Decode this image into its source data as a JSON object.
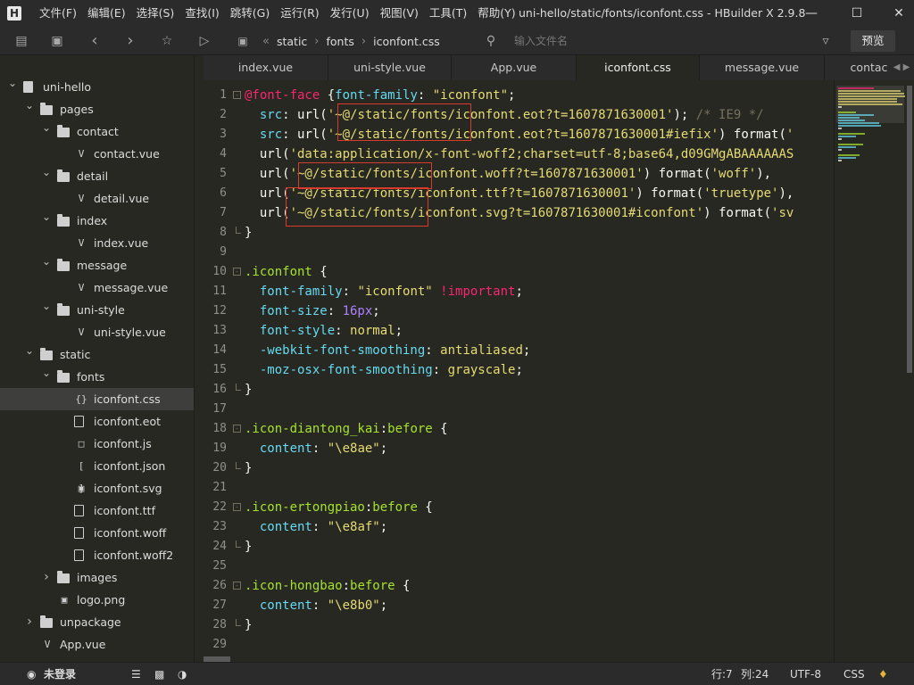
{
  "titlebar": {
    "app_icon": "H",
    "menu": [
      "文件(F)",
      "编辑(E)",
      "选择(S)",
      "查找(I)",
      "跳转(G)",
      "运行(R)",
      "发行(U)",
      "视图(V)",
      "工具(T)",
      "帮助(Y)"
    ],
    "title": "uni-hello/static/fonts/iconfont.css - HBuilder X 2.9.8",
    "controls": [
      "minimize-icon",
      "maximize-icon",
      "close-icon"
    ]
  },
  "toolbar": {
    "icons": [
      "new-file-icon",
      "save-icon",
      "back-icon",
      "forward-icon",
      "star-icon",
      "run-icon"
    ],
    "breadcrumb": [
      "static",
      "fonts",
      "iconfont.css"
    ],
    "search_placeholder": "输入文件名",
    "filter_icon": "filter-icon",
    "preview_label": "预览"
  },
  "sidebar": {
    "items": [
      {
        "label": "uni-hello",
        "type": "project",
        "depth": 0,
        "expanded": true
      },
      {
        "label": "pages",
        "type": "folder",
        "depth": 1,
        "expanded": true
      },
      {
        "label": "contact",
        "type": "folder",
        "depth": 2,
        "expanded": true
      },
      {
        "label": "contact.vue",
        "type": "vue",
        "depth": 3
      },
      {
        "label": "detail",
        "type": "folder",
        "depth": 2,
        "expanded": true
      },
      {
        "label": "detail.vue",
        "type": "vue",
        "depth": 3
      },
      {
        "label": "index",
        "type": "folder",
        "depth": 2,
        "expanded": true
      },
      {
        "label": "index.vue",
        "type": "vue",
        "depth": 3
      },
      {
        "label": "message",
        "type": "folder",
        "depth": 2,
        "expanded": true
      },
      {
        "label": "message.vue",
        "type": "vue",
        "depth": 3
      },
      {
        "label": "uni-style",
        "type": "folder",
        "depth": 2,
        "expanded": true
      },
      {
        "label": "uni-style.vue",
        "type": "vue",
        "depth": 3
      },
      {
        "label": "static",
        "type": "folder",
        "depth": 1,
        "expanded": true
      },
      {
        "label": "fonts",
        "type": "folder",
        "depth": 2,
        "expanded": true
      },
      {
        "label": "iconfont.css",
        "type": "css",
        "depth": 3,
        "selected": true
      },
      {
        "label": "iconfont.eot",
        "type": "file",
        "depth": 3
      },
      {
        "label": "iconfont.js",
        "type": "js",
        "depth": 3
      },
      {
        "label": "iconfont.json",
        "type": "json",
        "depth": 3
      },
      {
        "label": "iconfont.svg",
        "type": "image",
        "depth": 3
      },
      {
        "label": "iconfont.ttf",
        "type": "file",
        "depth": 3
      },
      {
        "label": "iconfont.woff",
        "type": "file",
        "depth": 3
      },
      {
        "label": "iconfont.woff2",
        "type": "file",
        "depth": 3
      },
      {
        "label": "images",
        "type": "folder",
        "depth": 2,
        "expanded": false
      },
      {
        "label": "logo.png",
        "type": "image",
        "depth": 2
      },
      {
        "label": "unpackage",
        "type": "folder",
        "depth": 1,
        "expanded": false
      },
      {
        "label": "App.vue",
        "type": "vue",
        "depth": 1
      }
    ]
  },
  "tabs": [
    {
      "label": "index.vue",
      "active": false
    },
    {
      "label": "uni-style.vue",
      "active": false
    },
    {
      "label": "App.vue",
      "active": false
    },
    {
      "label": "iconfont.css",
      "active": true
    },
    {
      "label": "message.vue",
      "active": false
    },
    {
      "label": "contac",
      "active": false
    }
  ],
  "editor": {
    "lines": [
      [
        [
          "k",
          "@font-face"
        ],
        [
          "w",
          " {"
        ],
        [
          "p",
          "font-family"
        ],
        [
          "w",
          ": "
        ],
        [
          "s",
          "\"iconfont\""
        ],
        [
          "w",
          ";"
        ]
      ],
      [
        [
          "w",
          "  "
        ],
        [
          "p",
          "src"
        ],
        [
          "w",
          ": "
        ],
        [
          "w",
          "url("
        ],
        [
          "s",
          "'~@/static/fonts/iconfont.eot?t=1607871630001'"
        ],
        [
          "w",
          ");"
        ],
        [
          "c",
          " /* IE9 */"
        ]
      ],
      [
        [
          "w",
          "  "
        ],
        [
          "p",
          "src"
        ],
        [
          "w",
          ": "
        ],
        [
          "w",
          "url("
        ],
        [
          "s",
          "'~@/static/fonts/iconfont.eot?t=1607871630001#iefix'"
        ],
        [
          "w",
          ") "
        ],
        [
          "w",
          "format("
        ],
        [
          "s",
          "'"
        ]
      ],
      [
        [
          "w",
          "  "
        ],
        [
          "w",
          "url("
        ],
        [
          "s",
          "'data:application/x-font-woff2;charset=utf-8;base64,d09GMgABAAAAAAS"
        ]
      ],
      [
        [
          "w",
          "  "
        ],
        [
          "w",
          "url("
        ],
        [
          "s",
          "'~@/static/fonts/iconfont.woff?t=1607871630001'"
        ],
        [
          "w",
          ") "
        ],
        [
          "w",
          "format("
        ],
        [
          "s",
          "'woff'"
        ],
        [
          "w",
          "),"
        ]
      ],
      [
        [
          "w",
          "  "
        ],
        [
          "w",
          "url("
        ],
        [
          "s",
          "'~@/static/fonts/iconfont.ttf?t=1607871630001'"
        ],
        [
          "w",
          ") "
        ],
        [
          "w",
          "format("
        ],
        [
          "s",
          "'truetype'"
        ],
        [
          "w",
          "),"
        ]
      ],
      [
        [
          "w",
          "  "
        ],
        [
          "w",
          "url("
        ],
        [
          "s",
          "'~@/static/fonts/iconfont.svg?t=1607871630001#iconfont'"
        ],
        [
          "w",
          ") "
        ],
        [
          "w",
          "format("
        ],
        [
          "s",
          "'sv"
        ]
      ],
      [
        [
          "w",
          "}"
        ]
      ],
      [],
      [
        [
          "sel",
          ".iconfont"
        ],
        [
          "w",
          " {"
        ]
      ],
      [
        [
          "w",
          "  "
        ],
        [
          "p",
          "font-family"
        ],
        [
          "w",
          ": "
        ],
        [
          "s",
          "\"iconfont\""
        ],
        [
          "w",
          " "
        ],
        [
          "k",
          "!important"
        ],
        [
          "w",
          ";"
        ]
      ],
      [
        [
          "w",
          "  "
        ],
        [
          "p",
          "font-size"
        ],
        [
          "w",
          ": "
        ],
        [
          "n",
          "16px"
        ],
        [
          "w",
          ";"
        ]
      ],
      [
        [
          "w",
          "  "
        ],
        [
          "p",
          "font-style"
        ],
        [
          "w",
          ": "
        ],
        [
          "s",
          "normal"
        ],
        [
          "w",
          ";"
        ]
      ],
      [
        [
          "w",
          "  "
        ],
        [
          "p",
          "-webkit-font-smoothing"
        ],
        [
          "w",
          ": "
        ],
        [
          "s",
          "antialiased"
        ],
        [
          "w",
          ";"
        ]
      ],
      [
        [
          "w",
          "  "
        ],
        [
          "p",
          "-moz-osx-font-smoothing"
        ],
        [
          "w",
          ": "
        ],
        [
          "s",
          "grayscale"
        ],
        [
          "w",
          ";"
        ]
      ],
      [
        [
          "w",
          "}"
        ]
      ],
      [],
      [
        [
          "sel",
          ".icon-diantong_kai"
        ],
        [
          "w",
          ":"
        ],
        [
          "sel",
          "before"
        ],
        [
          "w",
          " {"
        ]
      ],
      [
        [
          "w",
          "  "
        ],
        [
          "p",
          "content"
        ],
        [
          "w",
          ": "
        ],
        [
          "s",
          "\"\\e8ae\""
        ],
        [
          "w",
          ";"
        ]
      ],
      [
        [
          "w",
          "}"
        ]
      ],
      [],
      [
        [
          "sel",
          ".icon-ertongpiao"
        ],
        [
          "w",
          ":"
        ],
        [
          "sel",
          "before"
        ],
        [
          "w",
          " {"
        ]
      ],
      [
        [
          "w",
          "  "
        ],
        [
          "p",
          "content"
        ],
        [
          "w",
          ": "
        ],
        [
          "s",
          "\"\\e8af\""
        ],
        [
          "w",
          ";"
        ]
      ],
      [
        [
          "w",
          "}"
        ]
      ],
      [],
      [
        [
          "sel",
          ".icon-hongbao"
        ],
        [
          "w",
          ":"
        ],
        [
          "sel",
          "before"
        ],
        [
          "w",
          " {"
        ]
      ],
      [
        [
          "w",
          "  "
        ],
        [
          "p",
          "content"
        ],
        [
          "w",
          ": "
        ],
        [
          "s",
          "\"\\e8b0\""
        ],
        [
          "w",
          ";"
        ]
      ],
      [
        [
          "w",
          "}"
        ]
      ],
      []
    ]
  },
  "statusbar": {
    "login_label": "未登录",
    "row_label": "行:7",
    "col_label": "列:24",
    "encoding": "UTF-8",
    "language": "CSS"
  },
  "colors": {
    "background": "#272822",
    "chrome": "#2b2b2b",
    "highlight_box": "#d83a2b",
    "keyword": "#f92672",
    "property": "#66d9ef",
    "string": "#e6db74",
    "selector": "#a6e22e"
  }
}
